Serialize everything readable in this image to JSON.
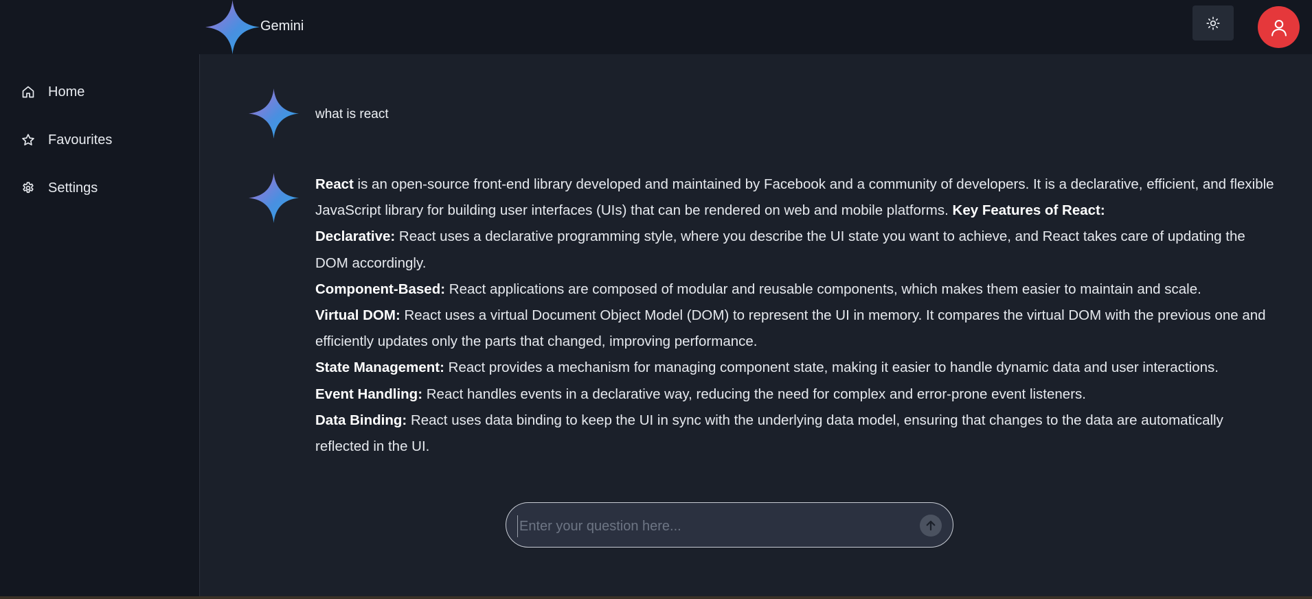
{
  "header": {
    "brand": "Gemini",
    "theme_toggle_icon": "sun-icon",
    "avatar_icon": "user-icon",
    "colors": {
      "avatar_bg": "#e5383b",
      "star_gradient_start": "#a16bd8",
      "star_gradient_end": "#2f9ce6"
    }
  },
  "sidebar": {
    "items": [
      {
        "label": "Home",
        "icon": "home-icon"
      },
      {
        "label": "Favourites",
        "icon": "star-icon"
      },
      {
        "label": "Settings",
        "icon": "gear-icon"
      }
    ]
  },
  "chat": {
    "question": "what is react",
    "answer": {
      "intro_bold": "React",
      "intro_text": " is an open-source front-end library developed and maintained by Facebook and a community of developers. It is a declarative, efficient, and flexible JavaScript library for building user interfaces (UIs) that can be rendered on web and mobile platforms. ",
      "features_heading": "Key Features of React:",
      "features": [
        {
          "title": "Declarative:",
          "text": " React uses a declarative programming style, where you describe the UI state you want to achieve, and React takes care of updating the DOM accordingly."
        },
        {
          "title": "Component-Based:",
          "text": " React applications are composed of modular and reusable components, which makes them easier to maintain and scale."
        },
        {
          "title": "Virtual DOM:",
          "text": " React uses a virtual Document Object Model (DOM) to represent the UI in memory. It compares the virtual DOM with the previous one and efficiently updates only the parts that changed, improving performance."
        },
        {
          "title": "State Management:",
          "text": " React provides a mechanism for managing component state, making it easier to handle dynamic data and user interactions."
        },
        {
          "title": "Event Handling:",
          "text": " React handles events in a declarative way, reducing the need for complex and error-prone event listeners."
        },
        {
          "title": "Data Binding:",
          "text": " React uses data binding to keep the UI in sync with the underlying data model, ensuring that changes to the data are automatically reflected in the UI."
        }
      ]
    }
  },
  "composer": {
    "placeholder": "Enter your question here...",
    "value": "",
    "send_icon": "arrow-up-icon"
  }
}
